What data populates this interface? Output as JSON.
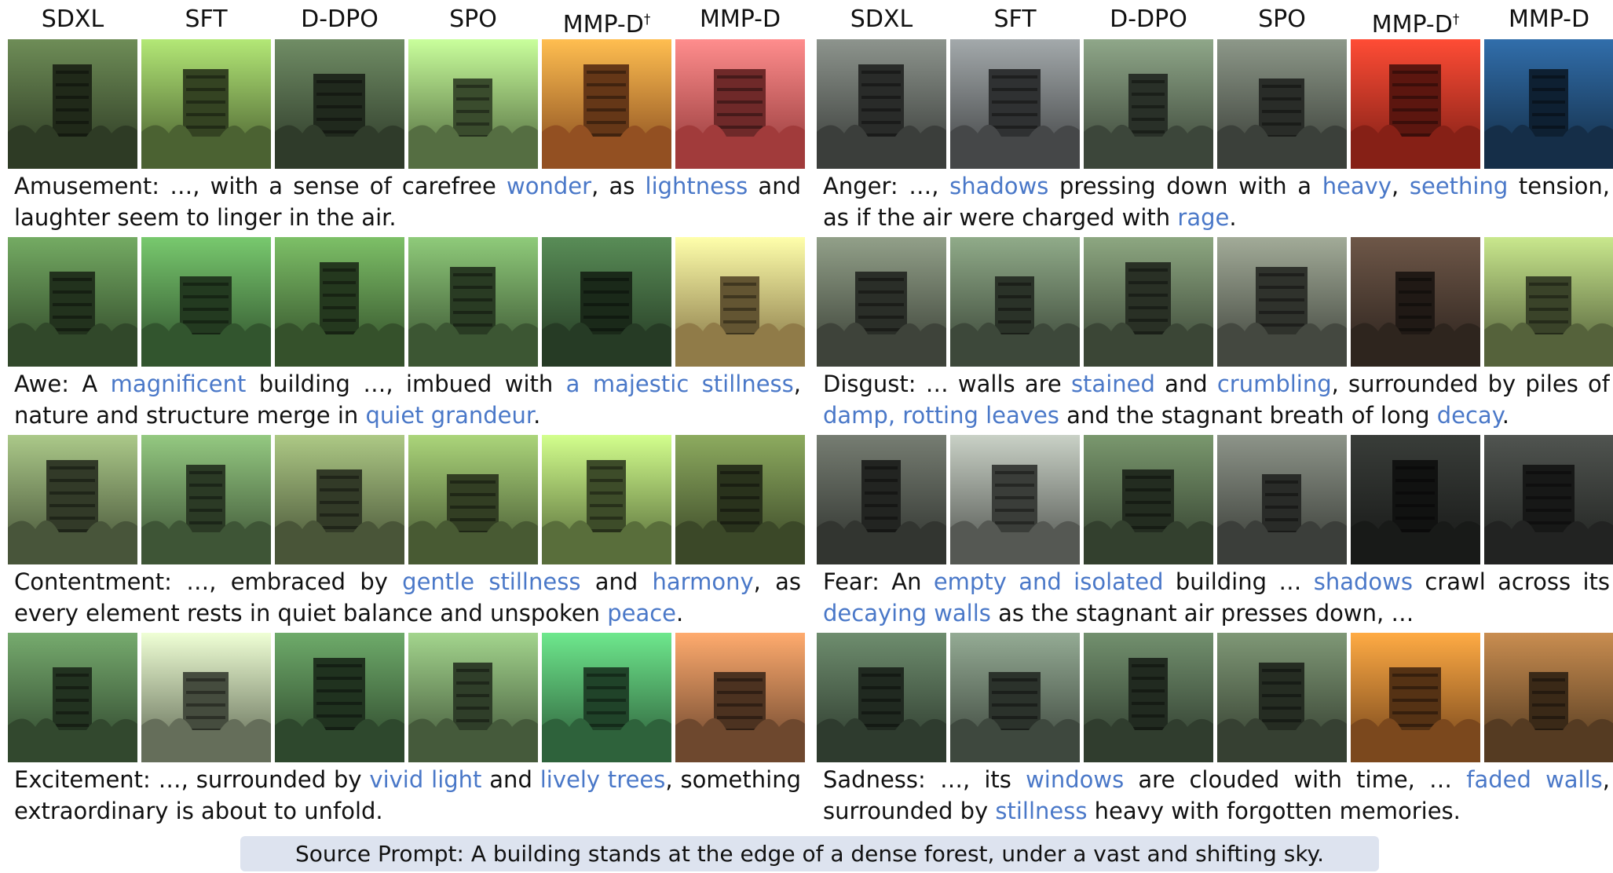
{
  "columns": [
    "SDXL",
    "SFT",
    "D-DPO",
    "SPO",
    "MMP-D",
    "MMP-D"
  ],
  "column_marks": [
    "",
    "",
    "",
    "",
    "†",
    ""
  ],
  "panels": [
    {
      "side": "left",
      "rows": [
        {
          "emotion": "amusement",
          "caption_parts": [
            {
              "t": "Amusement: …, with a sense of carefree ",
              "hl": false
            },
            {
              "t": "wonder",
              "hl": true
            },
            {
              "t": ", as ",
              "hl": false
            },
            {
              "t": "lightness",
              "hl": true
            },
            {
              "t": " and laughter seem to linger in the air.",
              "hl": false
            }
          ],
          "palette": [
            "#3a4a2e",
            "#5e7a3e",
            "#3b4a35",
            "#6a8a52",
            "#b8642a",
            "#c94a4a"
          ]
        },
        {
          "emotion": "awe",
          "caption_parts": [
            {
              "t": "Awe: A ",
              "hl": false
            },
            {
              "t": "magnificent",
              "hl": true
            },
            {
              "t": " building …, imbued with ",
              "hl": false
            },
            {
              "t": "a majestic stillness",
              "hl": true
            },
            {
              "t": ", nature and structure merge in ",
              "hl": false
            },
            {
              "t": "quiet grandeur",
              "hl": true
            },
            {
              "t": ".",
              "hl": false
            }
          ],
          "palette": [
            "#3d5a34",
            "#3f6a3a",
            "#426536",
            "#4b6b40",
            "#2f4a2e",
            "#b49a5a"
          ]
        },
        {
          "emotion": "contentment",
          "caption_parts": [
            {
              "t": "Contentment: …, embraced by ",
              "hl": false
            },
            {
              "t": "gentle stillness",
              "hl": true
            },
            {
              "t": " and ",
              "hl": false
            },
            {
              "t": "harmony",
              "hl": true
            },
            {
              "t": ", as every element rests in quiet balance and unspoken ",
              "hl": false
            },
            {
              "t": "peace",
              "hl": true
            },
            {
              "t": ".",
              "hl": false
            }
          ],
          "palette": [
            "#5a6a48",
            "#4e6a44",
            "#5b6a46",
            "#5a7040",
            "#6f8a4a",
            "#4a5a32"
          ]
        },
        {
          "emotion": "excitement",
          "caption_parts": [
            {
              "t": "Excitement: …, surrounded by ",
              "hl": false
            },
            {
              "t": "vivid light",
              "hl": true
            },
            {
              "t": " and ",
              "hl": false
            },
            {
              "t": "lively trees",
              "hl": true
            },
            {
              "t": ", something extraordinary is about to unfold.",
              "hl": false
            }
          ],
          "palette": [
            "#3e5a3a",
            "#7e8a70",
            "#3a5a38",
            "#56704a",
            "#3a7a4a",
            "#8a5a3a"
          ]
        }
      ]
    },
    {
      "side": "right",
      "rows": [
        {
          "emotion": "anger",
          "caption_parts": [
            {
              "t": "Anger: …, ",
              "hl": false
            },
            {
              "t": "shadows",
              "hl": true
            },
            {
              "t": " pressing down with a ",
              "hl": false
            },
            {
              "t": "heavy",
              "hl": true
            },
            {
              "t": ", ",
              "hl": false
            },
            {
              "t": "seething",
              "hl": true
            },
            {
              "t": " tension, as if the air were charged with ",
              "hl": false
            },
            {
              "t": "rage",
              "hl": true
            },
            {
              "t": ".",
              "hl": false
            }
          ],
          "palette": [
            "#4a4e4a",
            "#56595a",
            "#4b5848",
            "#4a5048",
            "#a8281c",
            "#1a3a5a"
          ]
        },
        {
          "emotion": "disgust",
          "caption_parts": [
            {
              "t": "Disgust: … walls are ",
              "hl": false
            },
            {
              "t": "stained",
              "hl": true
            },
            {
              "t": " and ",
              "hl": false
            },
            {
              "t": "crumbling",
              "hl": true
            },
            {
              "t": ", surrounded by piles of ",
              "hl": false
            },
            {
              "t": "damp, rotting leaves",
              "hl": true
            },
            {
              "t": " and the stagnant breath of long ",
              "hl": false
            },
            {
              "t": "decay",
              "hl": true
            },
            {
              "t": ".",
              "hl": false
            }
          ],
          "palette": [
            "#4d5448",
            "#4c5a48",
            "#4a5844",
            "#555a50",
            "#3a2e26",
            "#6a7a4a"
          ]
        },
        {
          "emotion": "fear",
          "caption_parts": [
            {
              "t": "Fear: An ",
              "hl": false
            },
            {
              "t": "empty and isolated",
              "hl": true
            },
            {
              "t": " building … ",
              "hl": false
            },
            {
              "t": "shadows",
              "hl": true
            },
            {
              "t": " crawl across its ",
              "hl": false
            },
            {
              "t": "decaying walls",
              "hl": true
            },
            {
              "t": " as the stagnant air presses down, …",
              "hl": false
            }
          ],
          "palette": [
            "#3e423c",
            "#6a6e68",
            "#40503a",
            "#4a4e48",
            "#1e201e",
            "#2a2c2a"
          ]
        },
        {
          "emotion": "sadness",
          "caption_parts": [
            {
              "t": "Sadness: …, its ",
              "hl": false
            },
            {
              "t": "windows",
              "hl": true
            },
            {
              "t": " are clouded with time, … ",
              "hl": false
            },
            {
              "t": "faded walls",
              "hl": true
            },
            {
              "t": ", surrounded by ",
              "hl": false
            },
            {
              "t": "stillness",
              "hl": true
            },
            {
              "t": " heavy with forgotten memories.",
              "hl": false
            }
          ],
          "palette": [
            "#3a4a3a",
            "#4e5a4e",
            "#3c4c3a",
            "#43503e",
            "#9a5a24",
            "#6a4a2a"
          ]
        }
      ]
    }
  ],
  "footer": "Source Prompt: A building stands at the edge of a dense forest, under a vast and shifting sky."
}
